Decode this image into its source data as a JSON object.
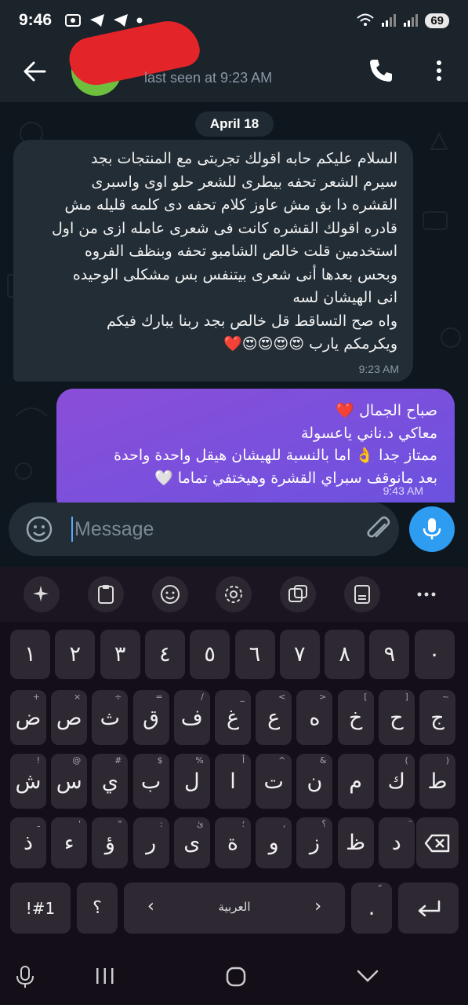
{
  "status_bar": {
    "time": "9:46",
    "battery": "69"
  },
  "header": {
    "contact_name": "",
    "last_seen": "last seen at 9:23 AM"
  },
  "chat": {
    "date": "April 18",
    "incoming": {
      "text": "السلام عليكم حابه اقولك تجربتى مع المنتجات بجد\nسيرم الشعر تحفه بيطرى للشعر حلو اوى واسبرى\nالقشره دا بق مش عاوز كلام تحفه دى كلمه قليله مش\nقادره اقولك القشره كانت فى شعرى عامله ازى من اول\nاستخدمين قلت خالص الشامبو تحفه وبنظف الفروه\nوبحس بعدها أنى شعرى بيتنفس بس مشكلى الوحيده\nانى الهيشان لسه\nواه صح التساقط قل خالص بجد ربنا يبارك فيكم\nويكرمكم يارب 😍😍😍😍❤️",
      "time": "9:23 AM"
    },
    "outgoing": {
      "text": "صباح الجمال ❤️\nمعاكي د.ناني ياعسولة\nممتاز جدا 👌 اما بالنسبة للهيشان هيقل واحدة واحدة\nبعد مانوقف سبراي القشرة وهيختفي تماما 🤍",
      "time": "9:43 AM"
    }
  },
  "input": {
    "placeholder": "Message"
  },
  "keyboard": {
    "number_row": [
      "١",
      "٢",
      "٣",
      "٤",
      "٥",
      "٦",
      "٧",
      "٨",
      "٩",
      "٠"
    ],
    "row1": [
      {
        "k": "ض",
        "h": "+"
      },
      {
        "k": "ص",
        "h": "×"
      },
      {
        "k": "ث",
        "h": "÷"
      },
      {
        "k": "ق",
        "h": "="
      },
      {
        "k": "ف",
        "h": "/"
      },
      {
        "k": "غ",
        "h": "_"
      },
      {
        "k": "ع",
        "h": "<"
      },
      {
        "k": "ه",
        "h": ">"
      },
      {
        "k": "خ",
        "h": "["
      },
      {
        "k": "ح",
        "h": "]"
      },
      {
        "k": "ج",
        "h": "~"
      }
    ],
    "row2": [
      {
        "k": "ش",
        "h": "!"
      },
      {
        "k": "س",
        "h": "@"
      },
      {
        "k": "ي",
        "h": "#"
      },
      {
        "k": "ب",
        "h": "$"
      },
      {
        "k": "ل",
        "h": "%"
      },
      {
        "k": "ا",
        "h": "أ"
      },
      {
        "k": "ت",
        "h": "^"
      },
      {
        "k": "ن",
        "h": "&"
      },
      {
        "k": "م",
        "h": ""
      },
      {
        "k": "ك",
        "h": "("
      },
      {
        "k": "ط",
        "h": ")"
      }
    ],
    "row3": [
      {
        "k": "ذ",
        "h": "ـ"
      },
      {
        "k": "ء",
        "h": "'"
      },
      {
        "k": "ؤ",
        "h": "\""
      },
      {
        "k": "ر",
        "h": ":"
      },
      {
        "k": "ى",
        "h": "ئ"
      },
      {
        "k": "ة",
        "h": "؛"
      },
      {
        "k": "و",
        "h": ","
      },
      {
        "k": "ز",
        "h": "؟"
      },
      {
        "k": "ظ",
        "h": ""
      },
      {
        "k": "د",
        "h": "ٓ"
      }
    ],
    "symbols_key": "!#1",
    "question_key": "؟",
    "space_label": "العربية",
    "period_key": ".",
    "period_hint": "ّ"
  }
}
